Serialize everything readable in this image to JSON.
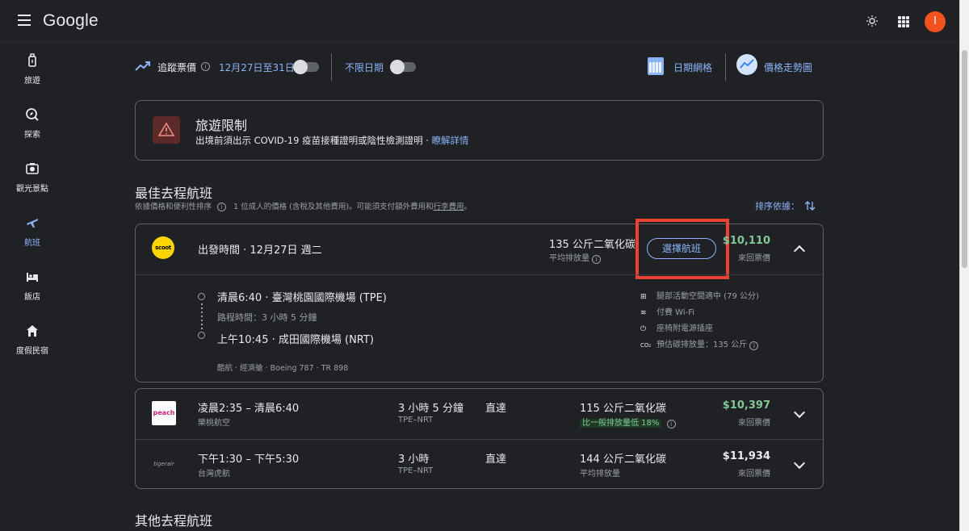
{
  "header": {
    "logo": "Google",
    "avatar_initial": "I"
  },
  "sidebar": {
    "items": [
      {
        "label": "旅遊",
        "icon": "luggage-icon"
      },
      {
        "label": "探索",
        "icon": "explore-icon"
      },
      {
        "label": "觀光景點",
        "icon": "camera-icon"
      },
      {
        "label": "航班",
        "icon": "flight-icon",
        "active": true
      },
      {
        "label": "飯店",
        "icon": "hotel-icon"
      },
      {
        "label": "度假民宿",
        "icon": "home-icon"
      }
    ]
  },
  "tracking": {
    "track_label": "追蹤票價",
    "date_range": "12月27日至31日",
    "track_enabled": false,
    "flexible_label": "不限日期",
    "flexible_enabled": false,
    "date_grid_label": "日期網格",
    "price_graph_label": "價格走勢圖"
  },
  "restriction": {
    "title": "旅遊限制",
    "body": "出境前須出示 COVID-19 疫苗接種證明或陰性檢測證明 · ",
    "link": "瞭解詳情"
  },
  "best_section": {
    "title": "最佳去程航班",
    "sub_left": "依據價格和便利性排序",
    "sub_right": "1 位成人的價格 (含稅及其他費用)。可能須支付額外費用和",
    "sub_link": "行李費用",
    "sub_end": "。",
    "sort_label": "排序依據："
  },
  "expanded_flight": {
    "airline_logo_text": "scoot",
    "departure": "出發時間 · 12月27日 週二",
    "co2": "135 公斤二氧化碳",
    "co2_sub": "平均排放量",
    "select_label": "選擇航班",
    "price": "$10,110",
    "price_sub": "來回票價",
    "dep_segment": "清晨6:40 · 臺灣桃園國際機場 (TPE)",
    "duration": "路程時間：3 小時 5 分鐘",
    "arr_segment": "上午10:45 · 成田國際機場 (NRT)",
    "meta": "酷航 · 經濟艙 · Boeing 787 · TR 898",
    "amenities": [
      {
        "icon": "legroom-icon",
        "glyph": "⊞",
        "text": "腿部活動空間適中 (79 公分)"
      },
      {
        "icon": "wifi-icon",
        "glyph": "≋",
        "text": "付費 Wi-Fi"
      },
      {
        "icon": "power-icon",
        "glyph": "⏻",
        "text": "座椅附電源插座"
      },
      {
        "icon": "co2-icon",
        "glyph": "CO₂",
        "text": "預估碳排放量：135 公斤"
      }
    ]
  },
  "flights": [
    {
      "logo": "peach",
      "times": "凌晨2:35 – 清晨6:40",
      "airline": "樂桃航空",
      "duration": "3 小時 5 分鐘",
      "route": "TPE–NRT",
      "stops": "直達",
      "co2": "115 公斤二氧化碳",
      "co2_sub": "比一般排放量低 18%",
      "price": "$10,397",
      "price_sub": "來回票價",
      "price_color": "#81c995"
    },
    {
      "logo": "tigerair",
      "times": "下午1:30 – 下午5:30",
      "airline": "台灣虎航",
      "duration": "3 小時",
      "route": "TPE–NRT",
      "stops": "直達",
      "co2": "144 公斤二氧化碳",
      "co2_sub": "平均排放量",
      "price": "$11,934",
      "price_sub": "來回票價",
      "price_color": "#e8eaed"
    }
  ],
  "other_section": {
    "title": "其他去程航班"
  }
}
